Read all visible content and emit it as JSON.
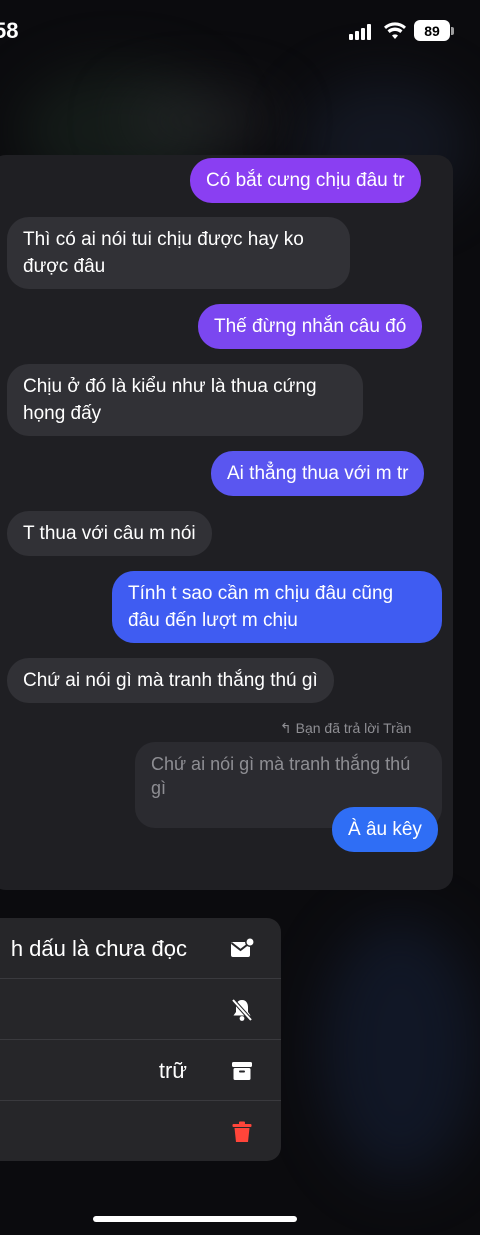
{
  "status_bar": {
    "time": "58",
    "battery": "89"
  },
  "messages": [
    {
      "type": "sent",
      "text": "Có bắt cưng chịu đâu tr",
      "color": "#8a3ff2"
    },
    {
      "type": "received",
      "text": "Thì có ai nói tui chịu được hay ko được đâu"
    },
    {
      "type": "sent",
      "text": "Thế đừng nhắn câu đó",
      "color": "#7b47f0"
    },
    {
      "type": "received",
      "text": "Chịu ở đó là kiểu như là thua cứng họng đấy"
    },
    {
      "type": "sent",
      "text": "Ai thẳng thua với m tr",
      "color": "#5a56f0"
    },
    {
      "type": "received",
      "text": "T thua với câu m nói"
    },
    {
      "type": "sent",
      "text": "Tính t sao cần m chịu đâu cũng đâu đến lượt m chịu",
      "color": "#3f5cf2"
    },
    {
      "type": "received",
      "text": "Chứ ai nói gì mà tranh thắng thú gì"
    }
  ],
  "reply": {
    "label": "Bạn đã trả lời Trần",
    "quote": "Chứ ai nói gì mà tranh thắng thú gì",
    "message": "À âu kêy",
    "color": "#2f6ef5"
  },
  "menu": {
    "items": [
      {
        "label": "h dấu là chưa đọc",
        "icon": "mark-unread-icon"
      },
      {
        "label": "",
        "icon": "bell-slash-icon"
      },
      {
        "label": " trữ",
        "icon": "archive-icon"
      },
      {
        "label": "",
        "icon": "trash-icon",
        "color": "#ff453a"
      }
    ]
  }
}
